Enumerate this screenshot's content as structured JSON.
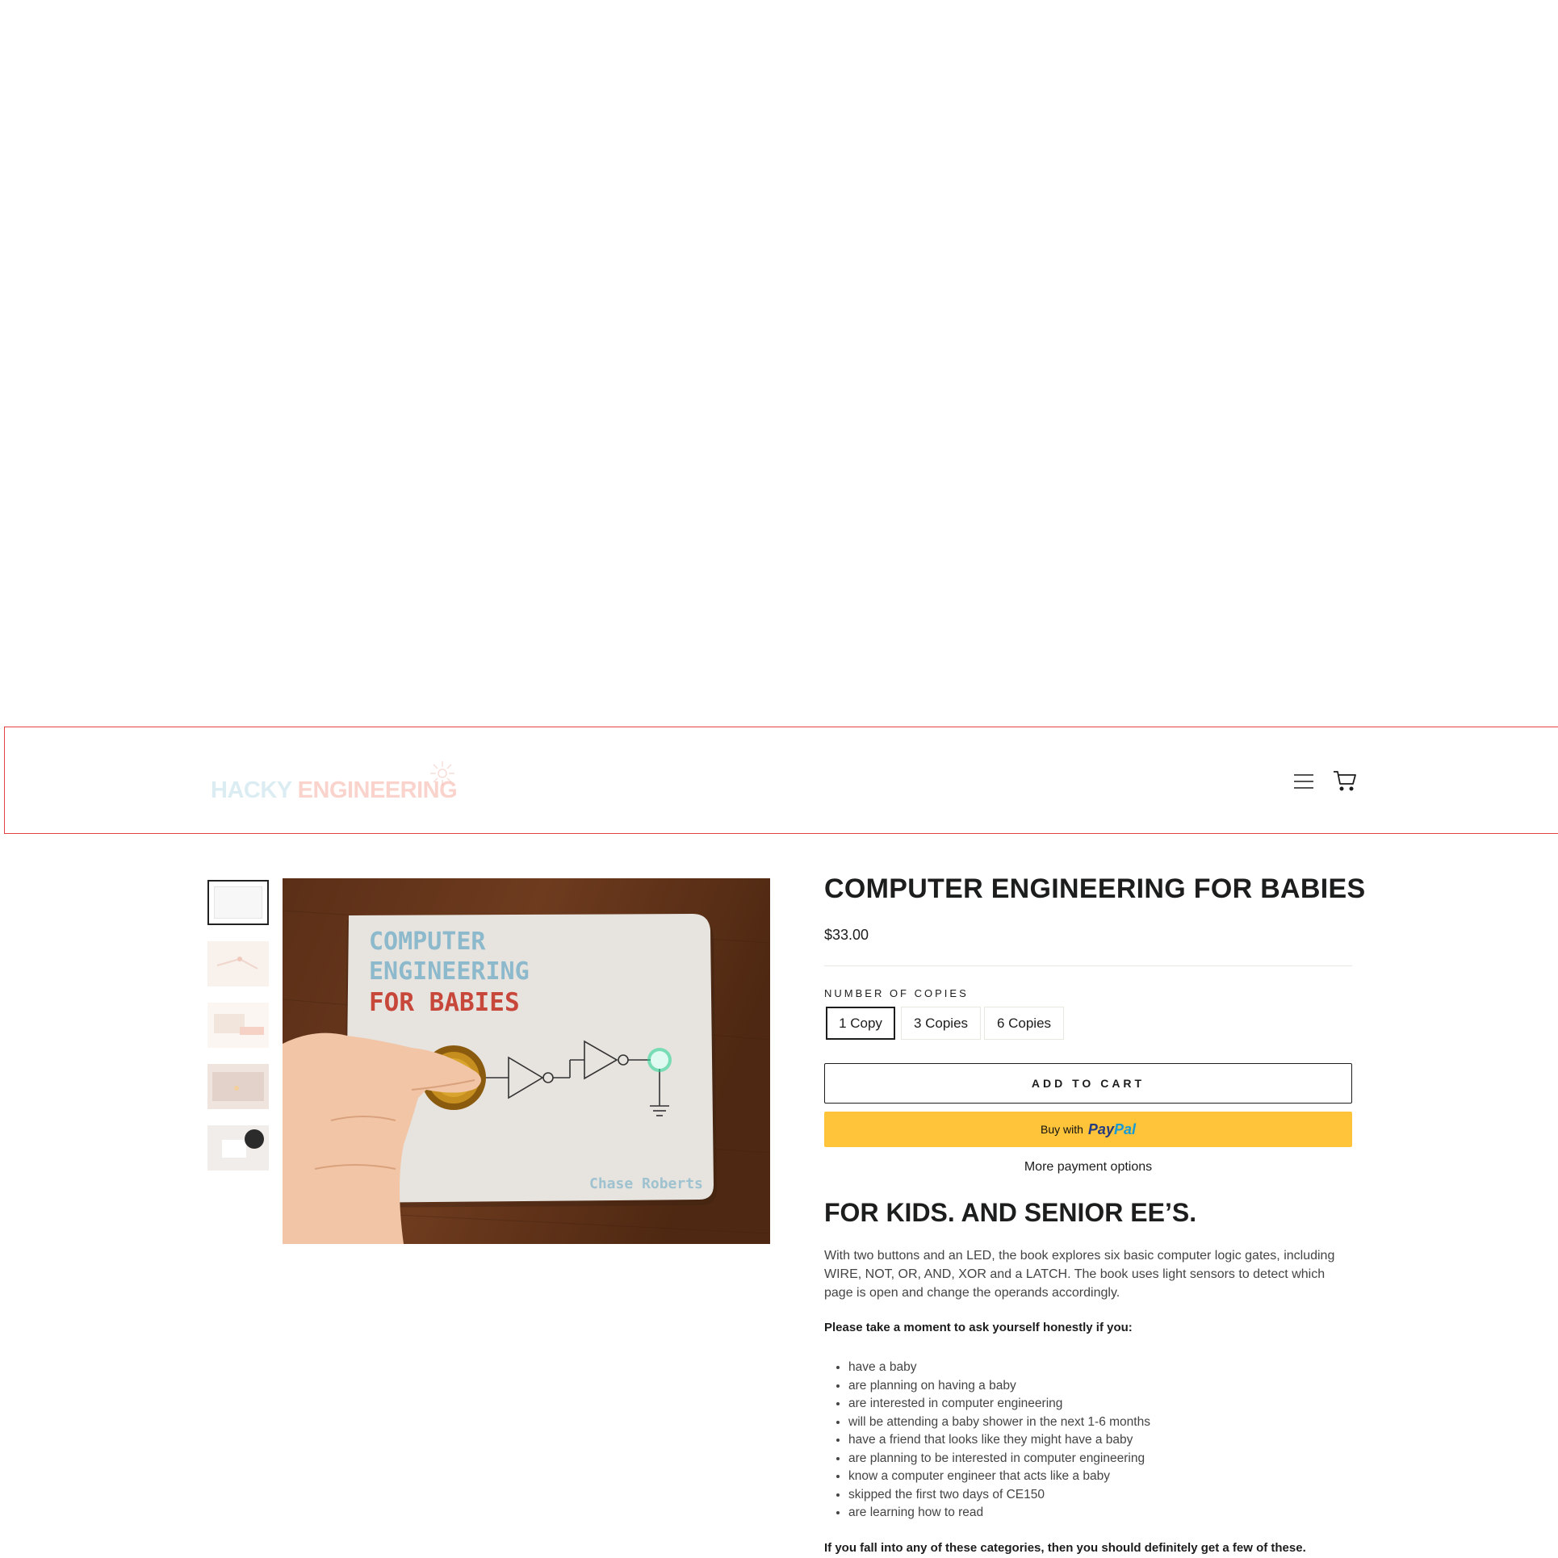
{
  "header": {
    "logo_text_a": "HACKY",
    "logo_text_b": "ENGINEERING",
    "menu_icon": "hamburger-menu-icon",
    "cart_icon": "shopping-cart-icon"
  },
  "gallery": {
    "thumbnails": [
      "thumbnail-1",
      "thumbnail-2",
      "thumbnail-3",
      "thumbnail-4",
      "thumbnail-5"
    ],
    "active_index": 0,
    "book_cover": {
      "title_line1": "COMPUTER",
      "title_line2": "ENGINEERING",
      "title_line3": "FOR BABIES",
      "author": "Chase Roberts"
    }
  },
  "product": {
    "title": "COMPUTER ENGINEERING FOR BABIES",
    "price": "$33.00",
    "variant_label": "NUMBER OF COPIES",
    "variants": [
      "1 Copy",
      "3 Copies",
      "6 Copies"
    ],
    "selected_variant": "1 Copy",
    "add_to_cart_label": "ADD TO CART",
    "paypal_prefix": "Buy with",
    "paypal_logo_a": "Pay",
    "paypal_logo_b": "Pal",
    "more_payment_options": "More payment options"
  },
  "description": {
    "tagline": "FOR KIDS. AND SENIOR EE’S.",
    "body": "With two buttons and an LED, the book explores six basic computer logic gates, including WIRE, NOT, OR, AND, XOR and a LATCH. The book uses light sensors to detect which page is open and change the operands accordingly.",
    "prompt": "Please take a moment to ask yourself honestly if you:",
    "bullets": [
      "have a baby",
      "are planning on having a baby",
      "are interested in computer engineering",
      "will be attending a baby shower in the next 1-6 months",
      "have a friend that looks like they might have a baby",
      "are planning to be interested in computer engineering",
      "know a computer engineer that acts like a baby",
      "skipped the first two days of CE150",
      "are learning how to read"
    ],
    "closing": "If you fall into any of these categories, then you should definitely get a few of these."
  },
  "colors": {
    "header_border": "#e34141",
    "paypal_yellow": "#ffc439",
    "text_dark": "#1c1d1d"
  }
}
